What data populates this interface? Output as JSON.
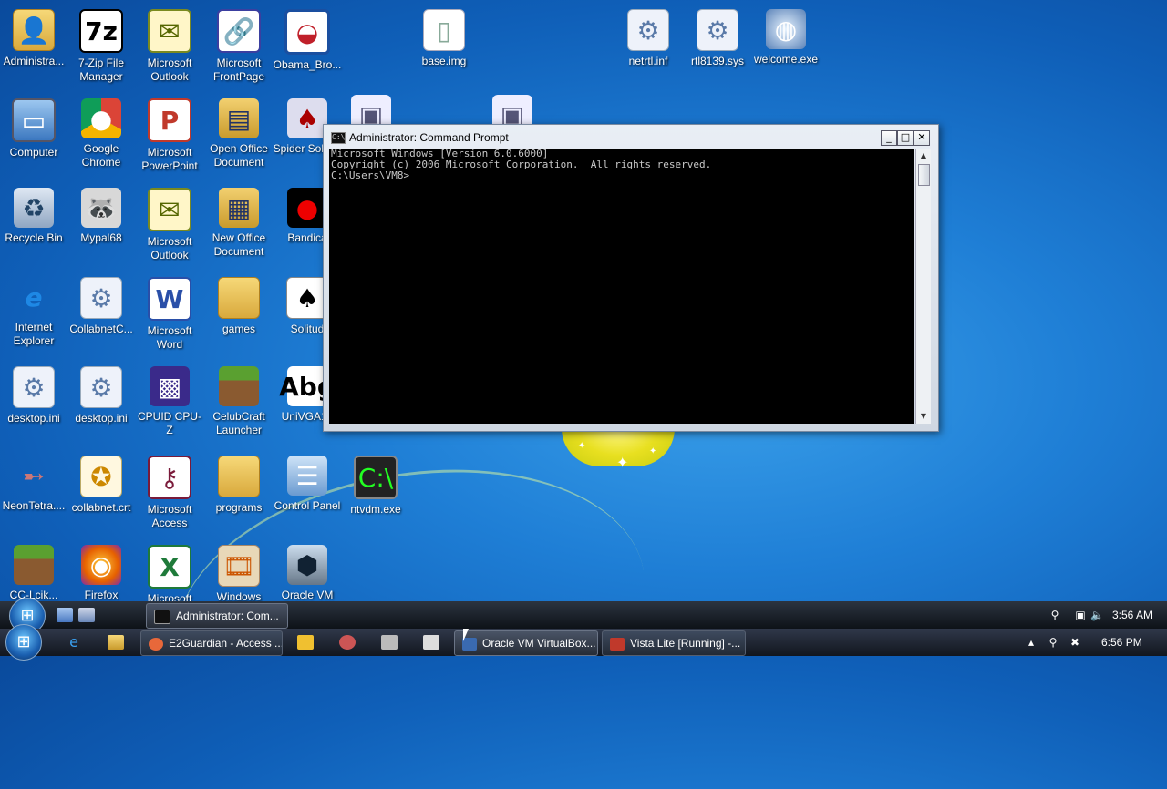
{
  "desktop_icons": [
    {
      "label": "Administra...",
      "icon": "user-folder-icon"
    },
    {
      "label": "7-Zip File Manager",
      "icon": "7zip-icon"
    },
    {
      "label": "Microsoft Outlook",
      "icon": "outlook-icon"
    },
    {
      "label": "Microsoft FrontPage",
      "icon": "frontpage-icon"
    },
    {
      "label": "Obama_Bro...",
      "icon": "obama-logo-icon"
    },
    {
      "label": "base.img",
      "icon": "file-icon"
    },
    {
      "label": "netrtl.inf",
      "icon": "settings-file-icon"
    },
    {
      "label": "rtl8139.sys",
      "icon": "settings-file-icon"
    },
    {
      "label": "welcome.exe",
      "icon": "globe-icon"
    },
    {
      "label": "Computer",
      "icon": "computer-icon"
    },
    {
      "label": "Google Chrome",
      "icon": "chrome-icon"
    },
    {
      "label": "Microsoft PowerPoint",
      "icon": "powerpoint-icon"
    },
    {
      "label": "Open Office Document",
      "icon": "openoffice-icon"
    },
    {
      "label": "Spider Solitud",
      "icon": "spider-solitaire-icon"
    },
    {
      "label": "Recycle Bin",
      "icon": "recycle-bin-icon"
    },
    {
      "label": "Mypal68",
      "icon": "mypal-icon"
    },
    {
      "label": "Microsoft Outlook",
      "icon": "outlook-icon"
    },
    {
      "label": "New Office Document",
      "icon": "office-document-icon"
    },
    {
      "label": "Bandica",
      "icon": "bandicam-icon"
    },
    {
      "label": "Internet Explorer",
      "icon": "internet-explorer-icon"
    },
    {
      "label": "CollabnetC...",
      "icon": "collabnet-icon"
    },
    {
      "label": "Microsoft Word",
      "icon": "word-icon"
    },
    {
      "label": "games",
      "icon": "folder-icon"
    },
    {
      "label": "Solitud",
      "icon": "solitaire-icon"
    },
    {
      "label": "desktop.ini",
      "icon": "settings-file-icon"
    },
    {
      "label": "desktop.ini",
      "icon": "settings-file-icon"
    },
    {
      "label": "CPUID CPU-Z",
      "icon": "cpuz-icon"
    },
    {
      "label": "CelubCraft Launcher",
      "icon": "minecraft-icon"
    },
    {
      "label": "UniVGA16",
      "icon": "font-file-icon"
    },
    {
      "label": "NeonTetra....",
      "icon": "fish-icon"
    },
    {
      "label": "collabnet.crt",
      "icon": "certificate-icon"
    },
    {
      "label": "Microsoft Access",
      "icon": "access-icon"
    },
    {
      "label": "programs",
      "icon": "folder-icon"
    },
    {
      "label": "Control Panel",
      "icon": "control-panel-icon"
    },
    {
      "label": "ntvdm.exe",
      "icon": "ntvdm-icon"
    },
    {
      "label": "CC-Lcik...",
      "icon": "minecraft-icon"
    },
    {
      "label": "Firefox",
      "icon": "firefox-icon"
    },
    {
      "label": "Microsoft",
      "icon": "excel-icon"
    },
    {
      "label": "Windows",
      "icon": "movie-maker-icon"
    },
    {
      "label": "Oracle VM",
      "icon": "virtualbox-icon"
    }
  ],
  "cmd_window": {
    "title": "Administrator: Command Prompt",
    "lines": [
      "Microsoft Windows [Version 6.0.6000]",
      "Copyright (c) 2006 Microsoft Corporation.  All rights reserved.",
      "",
      "C:\\Users\\VM8>"
    ],
    "minimize": "_",
    "maximize": "□",
    "close": "✕"
  },
  "guest_taskbar": {
    "task_label": "Administrator: Com...",
    "clock": "3:56 AM"
  },
  "host_taskbar": {
    "tasks": [
      {
        "label": "E2Guardian - Access ...",
        "color": "#e8683a"
      },
      {
        "label": "Oracle VM VirtualBox...",
        "color": "#3a6ab0"
      },
      {
        "label": "Vista Lite [Running] -...",
        "color": "#c0392b"
      }
    ],
    "clock": "6:56 PM"
  },
  "colors": {
    "desktop": "#1f7fd6",
    "console_bg": "#000000",
    "console_text": "#c8c8c8"
  }
}
